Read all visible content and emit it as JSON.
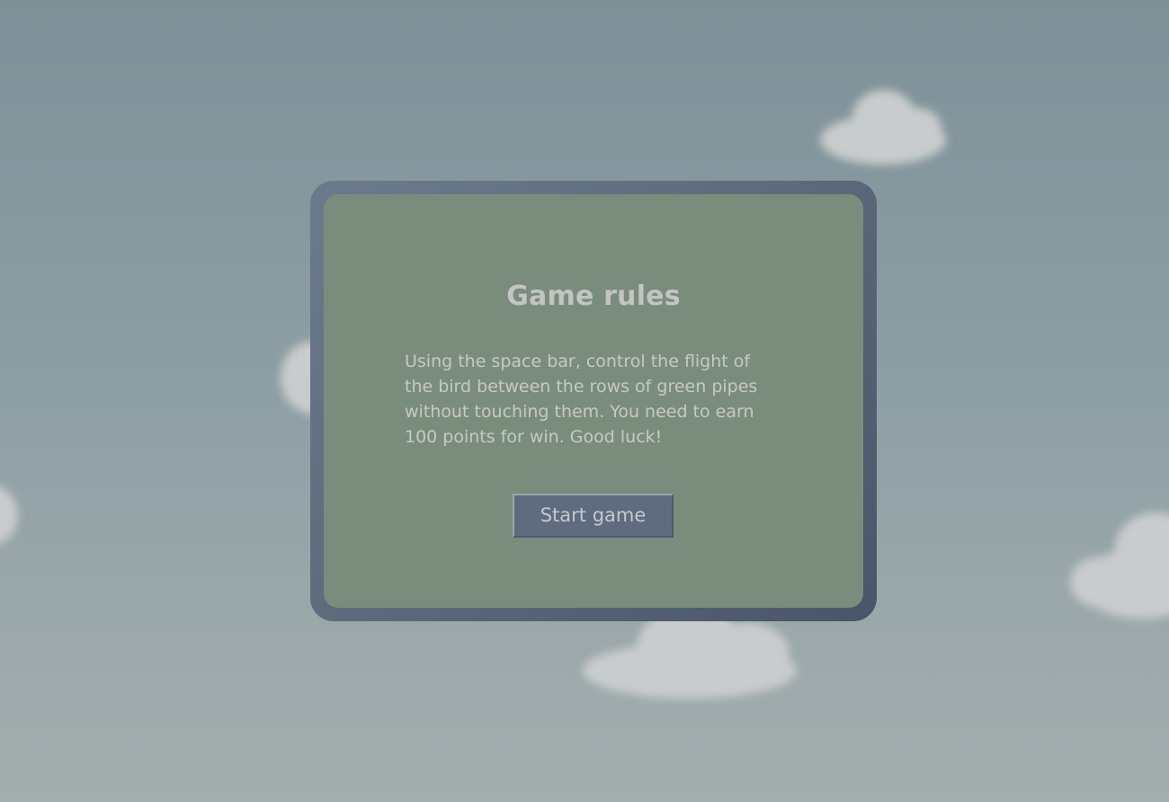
{
  "dialog": {
    "title": "Game rules",
    "rules": "Using the space bar, control the flight of the bird between the rows of green pipes without touching them. You need to earn 100 points for win. Good luck!",
    "start_label": "Start game"
  },
  "colors": {
    "sky": "#8c9ea4",
    "cloud": "#c9cccc",
    "modal_frame": "#5d6b7d",
    "modal_panel": "#7a8d7d",
    "button": "#5f6c7f",
    "text": "#c2c5c2"
  }
}
